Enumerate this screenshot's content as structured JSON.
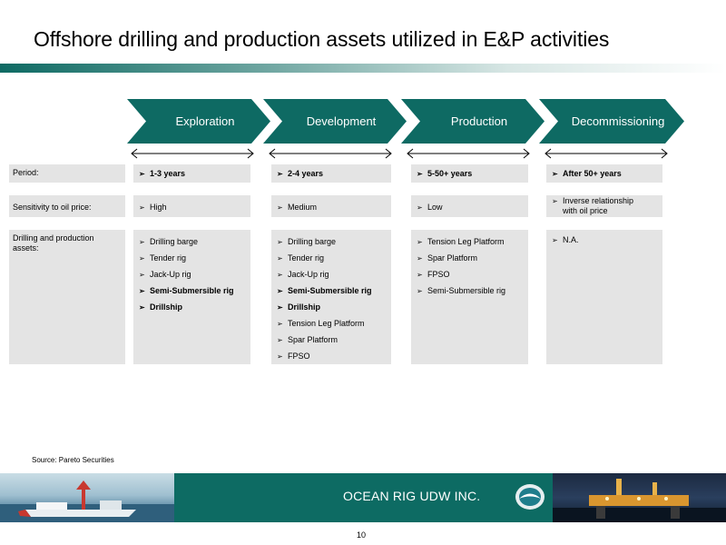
{
  "title": "Offshore drilling and production assets utilized in E&P activities",
  "colors": {
    "accent": "#0e6a63",
    "cell_bg": "#e4e4e4"
  },
  "stages": [
    "Exploration",
    "Development",
    "Production",
    "Decommissioning"
  ],
  "row_labels": {
    "period": "Period:",
    "sensitivity": "Sensitivity to oil price:",
    "assets": "Drilling and production assets:"
  },
  "period": [
    "1-3 years",
    "2-4 years",
    "5-50+ years",
    "After 50+ years"
  ],
  "sensitivity": [
    "High",
    "Medium",
    "Low",
    "Inverse relationship with oil price"
  ],
  "assets": {
    "exploration": [
      {
        "text": "Drilling barge",
        "bold": false
      },
      {
        "text": "Tender rig",
        "bold": false
      },
      {
        "text": "Jack-Up rig",
        "bold": false
      },
      {
        "text": "Semi-Submersible rig",
        "bold": true
      },
      {
        "text": "Drillship",
        "bold": true
      }
    ],
    "development": [
      {
        "text": "Drilling barge",
        "bold": false
      },
      {
        "text": "Tender rig",
        "bold": false
      },
      {
        "text": "Jack-Up rig",
        "bold": false
      },
      {
        "text": "Semi-Submersible rig",
        "bold": true
      },
      {
        "text": "Drillship",
        "bold": true
      },
      {
        "text": "Tension Leg Platform",
        "bold": false
      },
      {
        "text": "Spar Platform",
        "bold": false
      },
      {
        "text": "FPSO",
        "bold": false
      }
    ],
    "production": [
      {
        "text": "Tension Leg Platform",
        "bold": false
      },
      {
        "text": "Spar Platform",
        "bold": false
      },
      {
        "text": "FPSO",
        "bold": false
      },
      {
        "text": "Semi-Submersible rig",
        "bold": false
      }
    ],
    "decommissioning": [
      {
        "text": "N.A.",
        "bold": false
      }
    ]
  },
  "bullet_glyph": "➢",
  "source": "Source: Pareto Securities",
  "footer": {
    "company": "OCEAN RIG UDW INC."
  },
  "page_number": "10"
}
